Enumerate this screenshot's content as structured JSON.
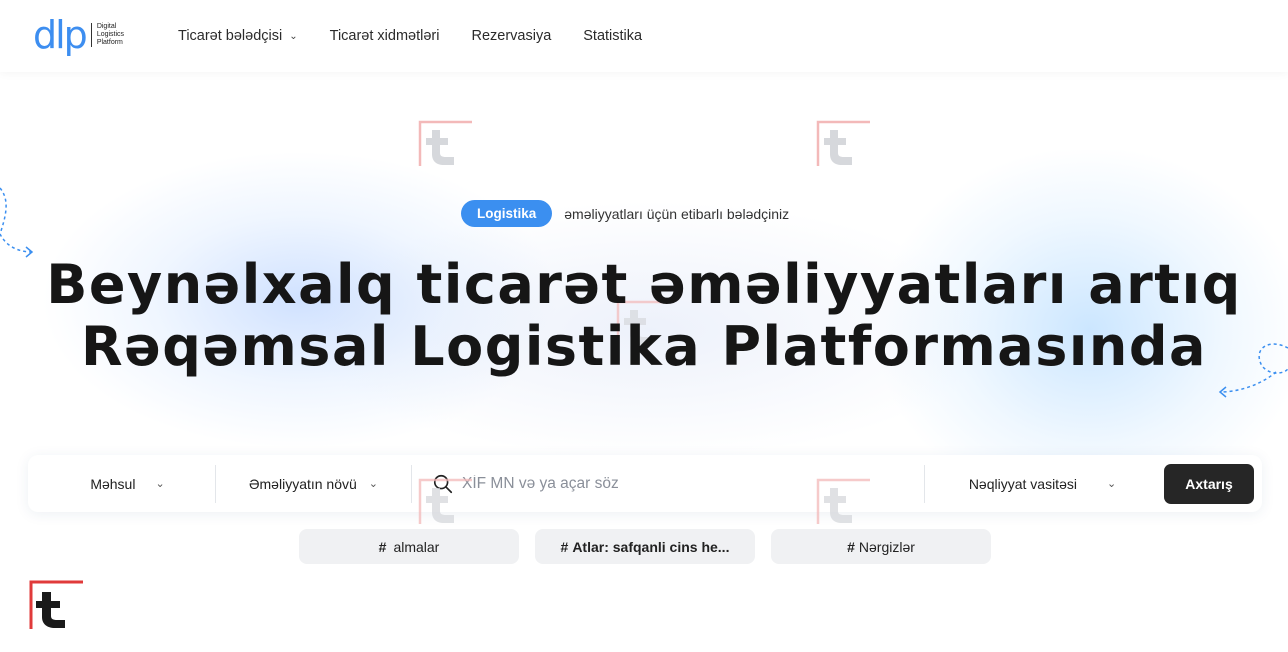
{
  "header": {
    "logo_mark": "dlp",
    "logo_lines": [
      "Digital",
      "Logistics",
      "Platform"
    ],
    "nav": [
      {
        "label": "Ticarət bələdçisi",
        "has_dropdown": true
      },
      {
        "label": "Ticarət xidmətləri",
        "has_dropdown": false
      },
      {
        "label": "Rezervasiya",
        "has_dropdown": false
      },
      {
        "label": "Statistika",
        "has_dropdown": false
      }
    ]
  },
  "hero": {
    "badge": "Logistika",
    "badge_text": "əməliyyatları üçün etibarlı bələdçiniz",
    "title_line1": "Beynəlxalq ticarət əməliyyatları artıq",
    "title_line2": "Rəqəmsal Logistika Platformasında"
  },
  "search": {
    "product_select": "Məhsul",
    "operation_select": "Əməliyyatın növü",
    "placeholder": "XİF MN və ya açar söz",
    "vehicle_select": "Nəqliyyat vasitəsi",
    "submit_label": "Axtarış"
  },
  "tags": [
    {
      "hash": "#",
      "label": "almalar"
    },
    {
      "hash": "#",
      "label": "Atlar: safqanli cins he..."
    },
    {
      "hash": "#",
      "label": "Nərgizlər"
    }
  ],
  "colors": {
    "accent": "#3b8ff0",
    "dark_button": "#262626",
    "brand_red": "#e03a3a"
  },
  "icons": {
    "search": "search-icon",
    "chevron": "chevron-down-icon",
    "watermark": "tl-logo-icon"
  }
}
